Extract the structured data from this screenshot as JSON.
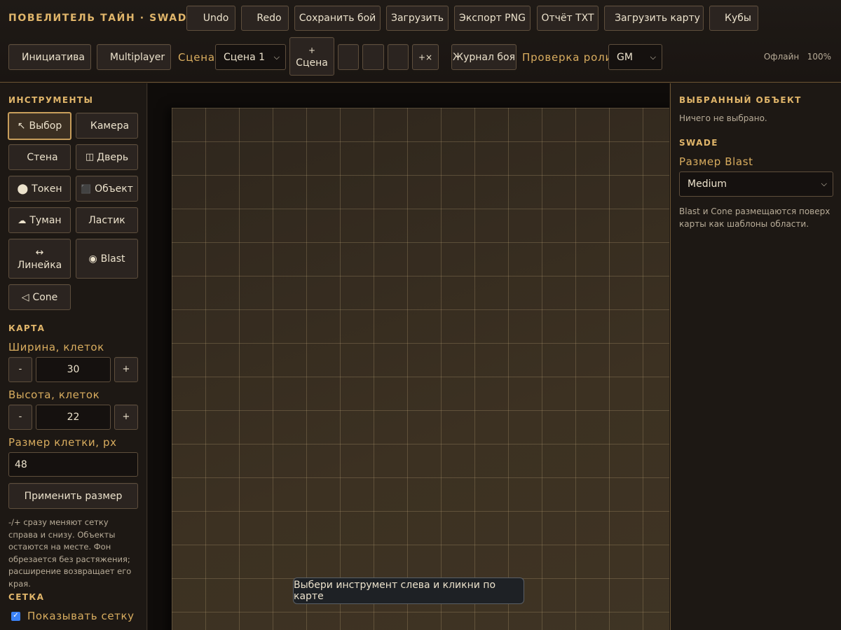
{
  "app": {
    "title": "ПОВЕЛИТЕЛЬ ТАЙН · SWADE"
  },
  "toolbar": {
    "undo": "Undo",
    "redo": "Redo",
    "save": "Сохранить бой",
    "load": "Загрузить",
    "export_png": "Экспорт PNG",
    "report_txt": "Отчёт TXT",
    "load_map": "Загрузить карту",
    "dice": "Кубы",
    "initiative": "Инициатива",
    "multiplayer": "Multiplayer",
    "scene_label": "Сцена",
    "scene_selected": "Сцена 1",
    "add_scene_plus": "+",
    "add_scene_text": "Сцена",
    "extra_button": "+×",
    "battle_log": "Журнал боя",
    "role_label": "Проверка роли",
    "role_selected": "GM",
    "status_text": "Офлайн",
    "zoom": "100%"
  },
  "tools": {
    "title": "ИНСТРУМЕНТЫ",
    "select": "Выбор",
    "camera": "Камера",
    "wall": "Стена",
    "door": "Дверь",
    "token": "Токен",
    "object": "Объект",
    "fog": "Туман",
    "eraser": "Ластик",
    "ruler": "Линейка",
    "blast": "Blast",
    "cone": "Cone"
  },
  "map_settings": {
    "title": "КАРТА",
    "width_label": "Ширина, клеток",
    "width_value": "30",
    "height_label": "Высота, клеток",
    "height_value": "22",
    "cell_label": "Размер клетки, px",
    "cell_value": "48",
    "minus": "-",
    "plus": "+",
    "apply": "Применить размер",
    "help": "-/+ сразу меняют сетку справа и снизу. Объекты остаются на месте. Фон обрезается без растяжения; расширение возвращает его края."
  },
  "grid": {
    "title": "СЕТКА",
    "show_label": "Показывать сетку"
  },
  "selection": {
    "title": "ВЫБРАННЫЙ ОБЪЕКТ",
    "empty": "Ничего не выбрано."
  },
  "swade": {
    "title": "SWADE",
    "blast_size_label": "Размер Blast",
    "blast_size_selected": "Medium",
    "help": "Blast и Cone размещаются поверх карты как шаблоны области."
  },
  "hint": "Выбери инструмент слева и кликни по карте",
  "colors": {
    "accent": "#e0b56a",
    "background": "#1c1713",
    "border": "#5e4e3c"
  }
}
